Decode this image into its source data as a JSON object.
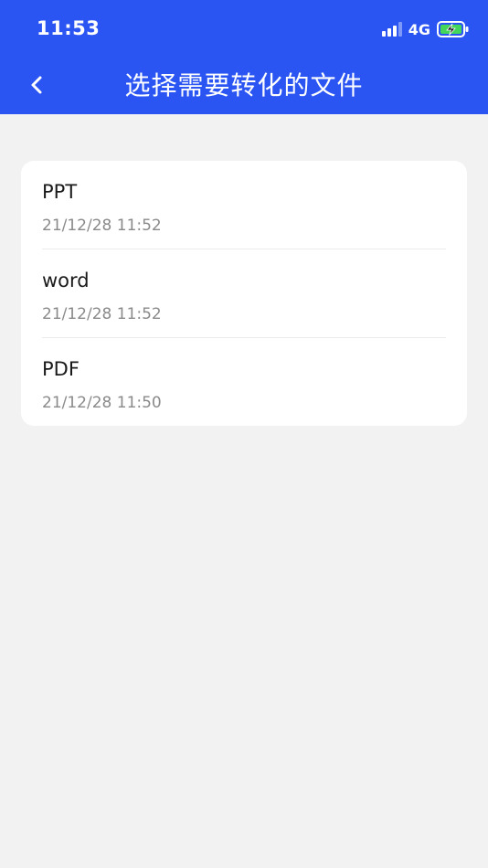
{
  "status_bar": {
    "time": "11:53",
    "network": "4G",
    "signal_bars": 3,
    "battery_charging": true
  },
  "header": {
    "back_icon": "chevron-left-icon",
    "title": "选择需要转化的文件",
    "background_color": "#2a55f3"
  },
  "files": [
    {
      "name": "PPT",
      "date": "21/12/28 11:52"
    },
    {
      "name": "word",
      "date": "21/12/28 11:52"
    },
    {
      "name": "PDF",
      "date": "21/12/28 11:50"
    }
  ]
}
